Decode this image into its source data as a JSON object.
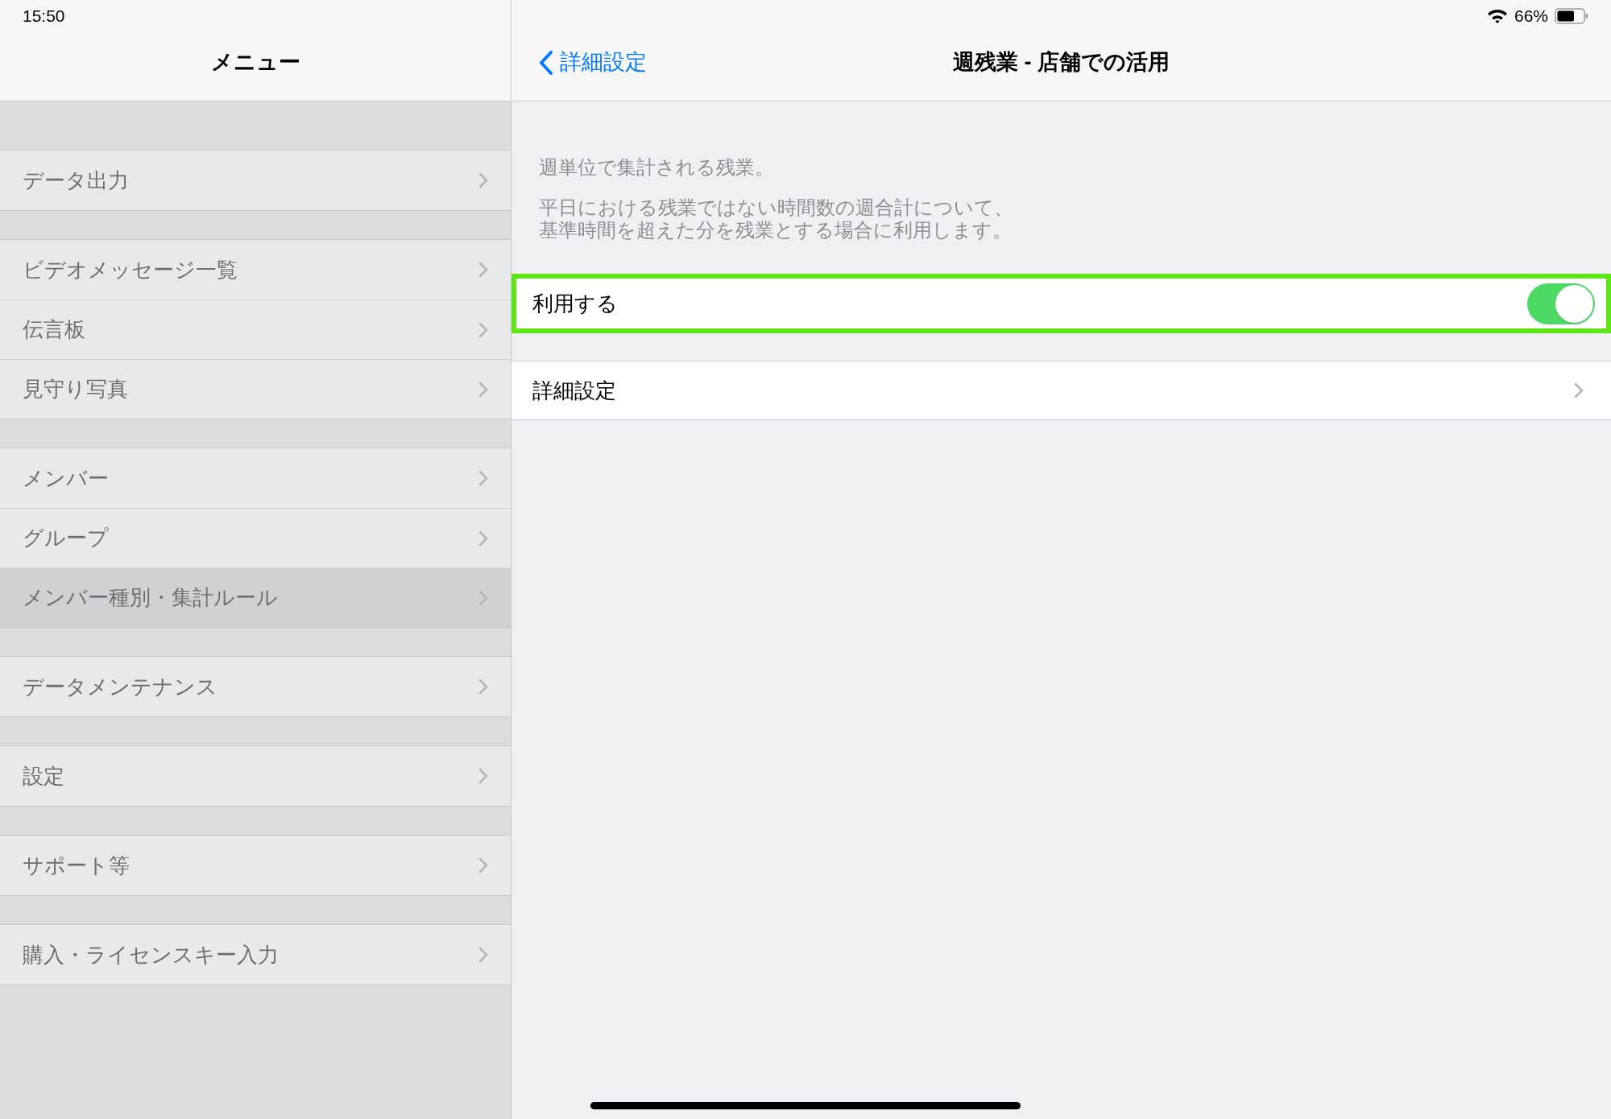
{
  "status_bar": {
    "time": "15:50",
    "battery_percent": "66%"
  },
  "sidebar": {
    "title": "メニュー",
    "sections": [
      {
        "items": [
          {
            "label": "データ出力",
            "selected": false
          }
        ]
      },
      {
        "items": [
          {
            "label": "ビデオメッセージ一覧",
            "selected": false
          },
          {
            "label": "伝言板",
            "selected": false
          },
          {
            "label": "見守り写真",
            "selected": false
          }
        ]
      },
      {
        "items": [
          {
            "label": "メンバー",
            "selected": false
          },
          {
            "label": "グループ",
            "selected": false
          },
          {
            "label": "メンバー種別・集計ルール",
            "selected": true
          }
        ]
      },
      {
        "items": [
          {
            "label": "データメンテナンス",
            "selected": false
          }
        ]
      },
      {
        "items": [
          {
            "label": "設定",
            "selected": false
          }
        ]
      },
      {
        "items": [
          {
            "label": "サポート等",
            "selected": false
          }
        ]
      },
      {
        "items": [
          {
            "label": "購入・ライセンスキー入力",
            "selected": false
          }
        ]
      }
    ]
  },
  "detail": {
    "back_label": "詳細設定",
    "title": "週残業 - 店舗での活用",
    "description": [
      [
        "週単位で集計される残業。"
      ],
      [
        "平日における残業ではない時間数の週合計について、",
        "基準時間を超えた分を残業とする場合に利用します。"
      ]
    ],
    "rows": [
      {
        "kind": "toggle",
        "label": "利用する",
        "on": true,
        "highlighted": true
      },
      {
        "kind": "link",
        "label": "詳細設定",
        "highlighted": false
      }
    ]
  }
}
